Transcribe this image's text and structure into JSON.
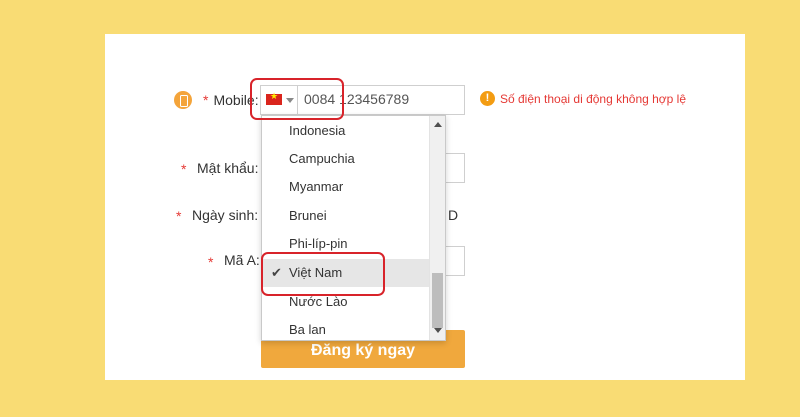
{
  "form": {
    "required_mark": "*",
    "mobile_label": "Mobile:",
    "phone_value": "0084 123456789",
    "error_icon": "!",
    "error_text": "Số điện thoại di động không hợp lệ",
    "password_label": "Mật khẩu:",
    "dob_label": "Ngày sinh:",
    "dob_tail": "D",
    "captcha_label": "Mã A:",
    "submit_label": "Đăng ký ngay"
  },
  "dropdown": {
    "items": [
      "Indonesia",
      "Campuchia",
      "Myanmar",
      "Brunei",
      "Phi-líp-pin",
      "Việt Nam",
      "Nước Lào",
      "Ba lan"
    ],
    "selected": "Việt Nam",
    "check_glyph": "✔"
  },
  "colors": {
    "background": "#f9dc74",
    "accent": "#f0a83d",
    "error": "#e53935",
    "highlight_box": "#d8232a"
  },
  "icons": {
    "mobile": "phone-icon",
    "flag": "vietnam-flag-icon",
    "error": "warning-circle-icon",
    "check": "checkmark-icon"
  }
}
